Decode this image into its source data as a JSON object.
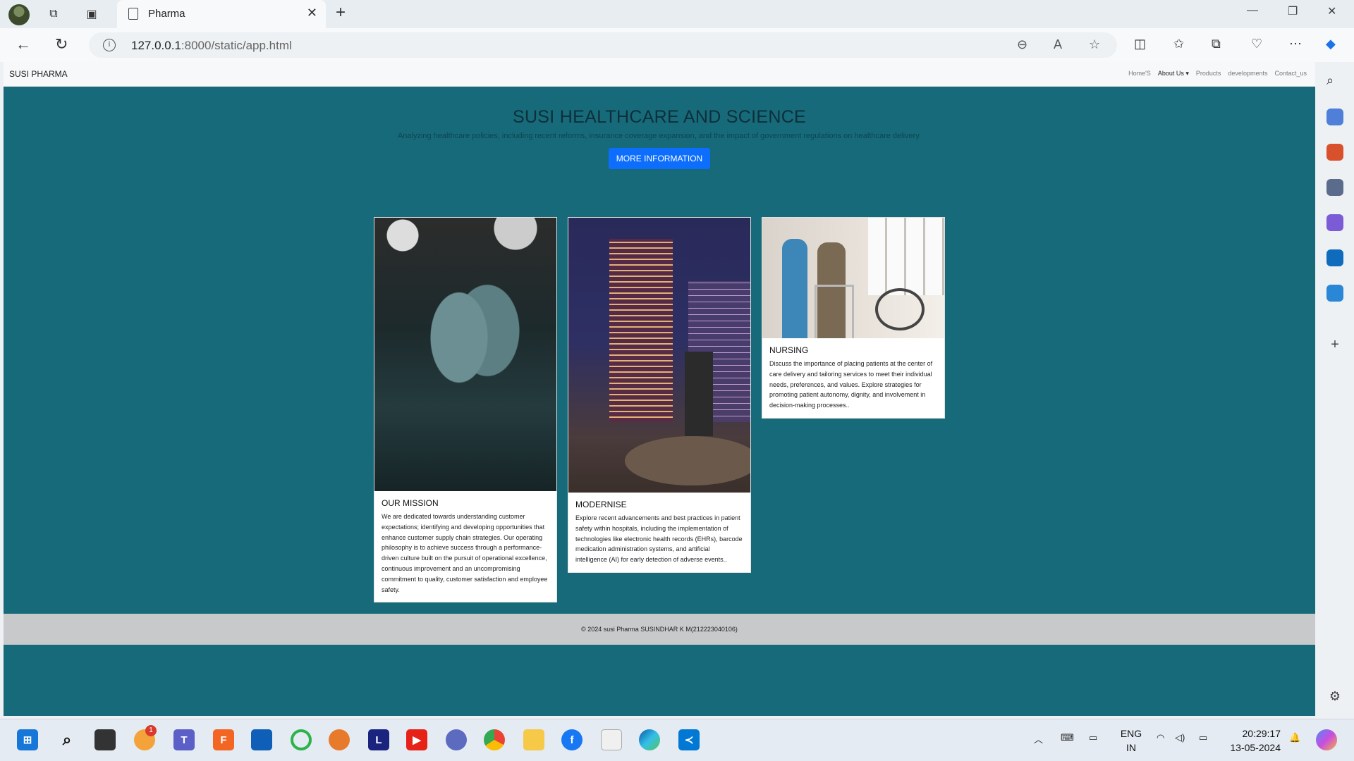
{
  "browser": {
    "tab_title": "Pharma",
    "url_host": "127.0.0.1",
    "url_path": ":8000/static/app.html"
  },
  "site": {
    "brand": "SUSI PHARMA",
    "nav": [
      "Home'S",
      "About Us",
      "Products",
      "developments",
      "Contact_us"
    ]
  },
  "hero": {
    "title": "SUSI HEALTHCARE AND SCIENCE",
    "subtitle": "Analyzing healthcare policies, including recent reforms, insurance coverage expansion, and the impact of government regulations on healthcare delivery.",
    "button": "MORE INFORMATION"
  },
  "cards": [
    {
      "title": "OUR MISSION",
      "text": "We are dedicated towards understanding customer expectations; identifying and developing opportunities that enhance customer supply chain strategies. Our operating philosophy is to achieve success through a performance-driven culture built on the pursuit of operational excellence, continuous improvement and an uncompromising commitment to quality, customer satisfaction and employee safety."
    },
    {
      "title": "MODERNISE",
      "text": "Explore recent advancements and best practices in patient safety within hospitals, including the implementation of technologies like electronic health records (EHRs), barcode medication administration systems, and artificial intelligence (AI) for early detection of adverse events.."
    },
    {
      "title": "NURSING",
      "text": "Discuss the importance of placing patients at the center of care delivery and tailoring services to meet their individual needs, preferences, and values. Explore strategies for promoting patient autonomy, dignity, and involvement in decision-making processes.."
    }
  ],
  "footer": "© 2024 susi Pharma SUSINDHAR K M(212223040106)",
  "taskbar": {
    "lang_top": "ENG",
    "lang_bottom": "IN",
    "time": "20:29:17",
    "date": "13-05-2024",
    "badge": "1"
  }
}
